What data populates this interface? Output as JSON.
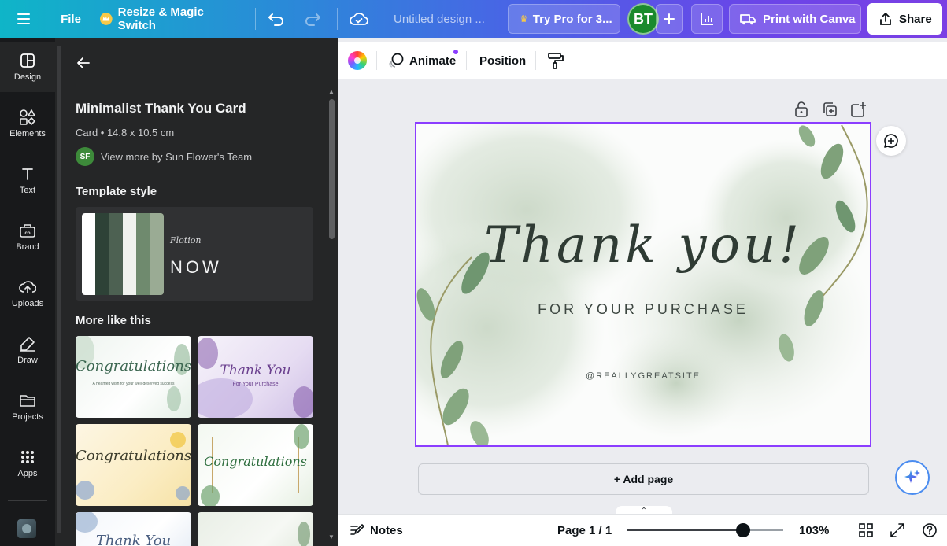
{
  "topbar": {
    "menu_icon": "hamburger-icon",
    "file_label": "File",
    "resize_label": "Resize & Magic Switch",
    "design_title": "Untitled design ...",
    "try_pro_label": "Try Pro for 3...",
    "avatar_initials": "BT",
    "print_label": "Print with Canva",
    "share_label": "Share"
  },
  "rail": {
    "items": [
      {
        "label": "Design",
        "icon": "design-icon"
      },
      {
        "label": "Elements",
        "icon": "elements-icon"
      },
      {
        "label": "Text",
        "icon": "text-icon"
      },
      {
        "label": "Brand",
        "icon": "brand-icon"
      },
      {
        "label": "Uploads",
        "icon": "uploads-icon"
      },
      {
        "label": "Draw",
        "icon": "draw-icon"
      },
      {
        "label": "Projects",
        "icon": "projects-icon"
      },
      {
        "label": "Apps",
        "icon": "apps-icon"
      }
    ]
  },
  "panel": {
    "template_title": "Minimalist Thank You Card",
    "template_meta": "Card • 14.8 x 10.5 cm",
    "creator_initials": "SF",
    "creator_link": "View more by Sun Flower's Team",
    "style_heading": "Template style",
    "style_font_script": "Flotion",
    "style_font_sans": "NOW",
    "style_colors": [
      "#ffffff",
      "#2e4237",
      "#4d6152",
      "#f0f2ee",
      "#6f8a6e",
      "#9aab94"
    ],
    "more_heading": "More like this",
    "more_items": [
      {
        "title": "Congratulations",
        "sub": "A heartfelt wish for your well-deserved success"
      },
      {
        "title": "Thank You",
        "sub": "For Your Purchase"
      },
      {
        "title": "Congratulations",
        "sub": ""
      },
      {
        "title": "Congratulations",
        "sub": ""
      },
      {
        "title": "Thank You",
        "sub": ""
      },
      {
        "title": "",
        "sub": ""
      }
    ]
  },
  "context_bar": {
    "animate_label": "Animate",
    "position_label": "Position"
  },
  "design": {
    "headline": "Thank you!",
    "subline": "FOR YOUR PURCHASE",
    "handle": "@REALLYGREATSITE"
  },
  "canvas": {
    "add_page_label": "+ Add page"
  },
  "bottombar": {
    "notes_label": "Notes",
    "page_indicator": "Page 1 / 1",
    "zoom_label": "103%",
    "zoom_fraction": 0.74
  },
  "colors": {
    "accent": "#8b3dff",
    "rail_bg": "#18191b",
    "panel_bg": "#252627",
    "avatar_bg": "#1a8a2c"
  }
}
